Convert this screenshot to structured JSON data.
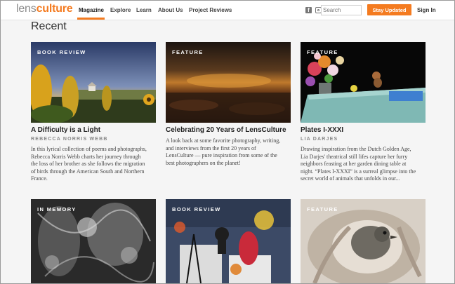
{
  "nav": {
    "logo_prefix": "lens",
    "logo_suffix": "culture",
    "items": [
      "Magazine",
      "Explore",
      "Learn",
      "About Us",
      "Project Reviews"
    ],
    "search_placeholder": "Search",
    "stay_updated": "Stay Updated",
    "sign_in": "Sign In",
    "accent": "#f47b20"
  },
  "section_heading": "Recent",
  "cards": [
    {
      "tag": "BOOK REVIEW",
      "title": "A Difficulty is a Light",
      "author": "REBECCA NORRIS WEBB",
      "lines": [
        "In this lyrical collection of poems and photographs,",
        "Rebecca Norris Webb charts her journey through",
        "the loss of her brother as she follows the migration",
        "of birds through the American South and Northern",
        "France."
      ]
    },
    {
      "tag": "FEATURE",
      "title": "Celebrating 20 Years of LensCulture",
      "author": "",
      "lines": [
        "A look back at some favorite photography, writing,",
        "and interviews from the first 20 years of",
        "LensCulture — pure inspiration from some of the",
        "best photographers on the planet!"
      ]
    },
    {
      "tag": "FEATURE",
      "title": "Plates I-XXXI",
      "author": "LIA DARJES",
      "lines": [
        "Drawing inspiration from the Dutch Golden Age,",
        "Lia Darjes' theatrical still lifes capture her furry",
        "neighbors feasting at her garden dining table at",
        "night. “Plates I-XXXI” is a surreal glimpse into the",
        "secret world of animals that unfolds in our..."
      ]
    },
    {
      "tag": "IN MEMORY"
    },
    {
      "tag": "BOOK REVIEW"
    },
    {
      "tag": "FEATURE"
    }
  ]
}
